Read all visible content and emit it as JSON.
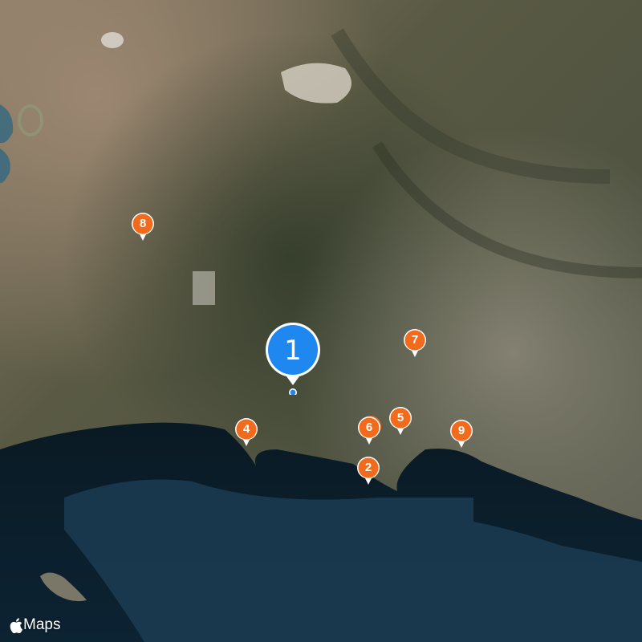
{
  "map": {
    "type": "satellite",
    "colors": {
      "marker_orange": "#f26b1d",
      "marker_blue": "#1e88f0",
      "sea_deep": "#0c2333",
      "sea_shallow": "#1c3c52"
    },
    "markers": [
      {
        "label": "1",
        "kind": "selected",
        "color": "#1e88f0"
      },
      {
        "label": "2",
        "kind": "pin",
        "color": "#f26b1d"
      },
      {
        "label": "4",
        "kind": "pin",
        "color": "#f26b1d"
      },
      {
        "label": "5",
        "kind": "pin",
        "color": "#f26b1d"
      },
      {
        "label": "6",
        "kind": "pin",
        "color": "#f26b1d"
      },
      {
        "label": "7",
        "kind": "pin",
        "color": "#f26b1d"
      },
      {
        "label": "8",
        "kind": "pin",
        "color": "#f26b1d"
      },
      {
        "label": "9",
        "kind": "pin",
        "color": "#f26b1d"
      }
    ],
    "attribution": {
      "icon": "apple-logo-icon",
      "text": "Maps"
    }
  }
}
